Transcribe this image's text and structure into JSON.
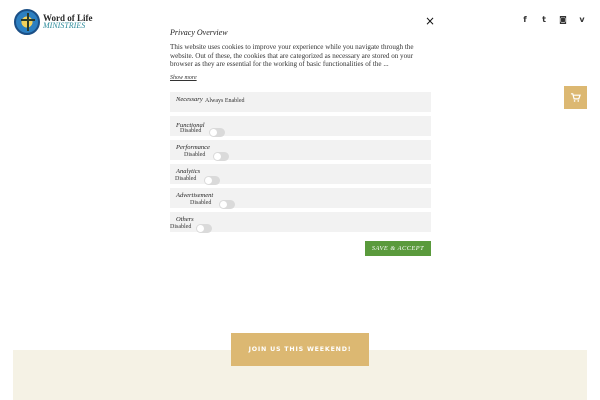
{
  "site": {
    "logo_line1": "Word of Life",
    "logo_line2": "MINISTRIES",
    "social": [
      {
        "glyph": "f",
        "icon": "facebook-icon"
      },
      {
        "glyph": "t",
        "icon": "twitter-icon"
      },
      {
        "glyph": "◙",
        "icon": "instagram-icon"
      },
      {
        "glyph": "v",
        "icon": "vimeo-icon"
      }
    ],
    "accent_color": "#dcb872",
    "cream_color": "#f5f2e5"
  },
  "modal": {
    "close_glyph": "×",
    "title": "Privacy Overview",
    "description": "This website uses cookies to improve your experience while you navigate through the website. Out of these, the cookies that are categorized as necessary are stored on your browser as they are essential for the working of basic functionalities of the ...",
    "show_more": "Show more",
    "categories": [
      {
        "name": "Necessary",
        "status": "Always Enabled"
      },
      {
        "name": "Functional",
        "status": "Disabled"
      },
      {
        "name": "Performance",
        "status": "Disabled"
      },
      {
        "name": "Analytics",
        "status": "Disabled"
      },
      {
        "name": "Advertisement",
        "status": "Disabled"
      },
      {
        "name": "Others",
        "status": "Disabled"
      }
    ],
    "save_label": "SAVE & ACCEPT",
    "save_color": "#5a9a3c"
  },
  "cta": {
    "join_label": "JOIN US THIS WEEKEND!"
  }
}
